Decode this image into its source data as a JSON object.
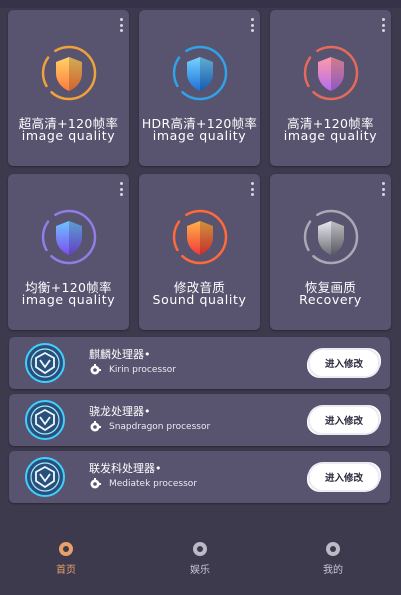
{
  "colors": {
    "background": "#3d3a4e",
    "card": "#58536f",
    "accent_active": "#e9a06b"
  },
  "modes": [
    {
      "title": "超高清+120帧率",
      "subtitle": "image quality",
      "icon": "orange-shield-icon",
      "ring": "#f0a23a",
      "fill_top": "#ffd36a",
      "fill_bottom": "#ff7a3a"
    },
    {
      "title": "HDR高清+120帧率",
      "subtitle": "image quality",
      "icon": "blue-shield-icon",
      "ring": "#2fa3e6",
      "fill_top": "#74d4ff",
      "fill_bottom": "#1f6fd8"
    },
    {
      "title": "高清+120帧率",
      "subtitle": "image quality",
      "icon": "pink-shield-icon",
      "ring": "#e46a5a",
      "fill_top": "#ff9aa8",
      "fill_bottom": "#b46cf0"
    },
    {
      "title": "均衡+120帧率",
      "subtitle": "image quality",
      "icon": "purple-shield-icon",
      "ring": "#8e7ee6",
      "fill_top": "#6fc3ff",
      "fill_bottom": "#7b4ef0"
    },
    {
      "title": "修改音质",
      "subtitle": "Sound quality",
      "icon": "red-shield-icon",
      "ring": "#ff6a3a",
      "fill_top": "#ffb347",
      "fill_bottom": "#f03a3a"
    },
    {
      "title": "恢复画质",
      "subtitle": "Recovery",
      "icon": "gray-shield-icon",
      "ring": "#a9a9b6",
      "fill_top": "#e8e8ee",
      "fill_bottom": "#6d6d78"
    }
  ],
  "processors": [
    {
      "name": "麒麟处理器•",
      "sub": "Kirin processor",
      "button": "进入修改",
      "icon": "processor-badge-icon"
    },
    {
      "name": "骁龙处理器•",
      "sub": "Snapdragon processor",
      "button": "进入修改",
      "icon": "processor-badge-icon"
    },
    {
      "name": "联发科处理器•",
      "sub": "Mediatek processor",
      "button": "进入修改",
      "icon": "processor-badge-icon"
    }
  ],
  "nav": [
    {
      "label": "首页",
      "icon": "home-icon",
      "active": true
    },
    {
      "label": "娱乐",
      "icon": "entertainment-icon",
      "active": false
    },
    {
      "label": "我的",
      "icon": "profile-icon",
      "active": false
    }
  ]
}
